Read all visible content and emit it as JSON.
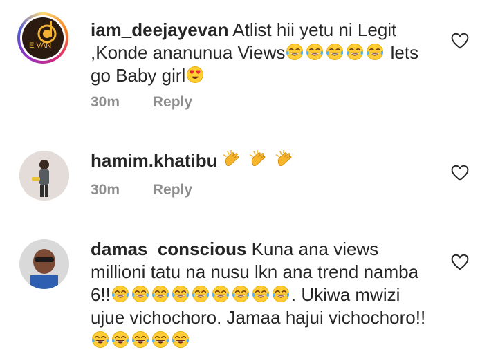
{
  "comments": [
    {
      "username": "iam_deejayevan",
      "segments": [
        {
          "t": "text",
          "v": "Atlist hii yetu ni Legit ,Konde ananunua Views"
        },
        {
          "t": "emoji",
          "name": "laugh"
        },
        {
          "t": "emoji",
          "name": "laugh"
        },
        {
          "t": "emoji",
          "name": "laugh"
        },
        {
          "t": "emoji",
          "name": "laugh"
        },
        {
          "t": "emoji",
          "name": "laugh"
        },
        {
          "t": "text",
          "v": " lets go Baby girl"
        },
        {
          "t": "emoji",
          "name": "heart-eyes"
        }
      ],
      "time": "30m",
      "reply": "Reply",
      "avatar_text": "E VAN"
    },
    {
      "username": "hamim.khatibu",
      "segments": [
        {
          "t": "emoji",
          "name": "clap"
        },
        {
          "t": "emoji",
          "name": "clap"
        },
        {
          "t": "emoji",
          "name": "clap"
        }
      ],
      "time": "30m",
      "reply": "Reply"
    },
    {
      "username": "damas_conscious",
      "segments": [
        {
          "t": "text",
          "v": "Kuna ana views millioni tatu na nusu lkn ana trend namba 6!!"
        },
        {
          "t": "emoji",
          "name": "laugh"
        },
        {
          "t": "emoji",
          "name": "laugh"
        },
        {
          "t": "emoji",
          "name": "laugh"
        },
        {
          "t": "emoji",
          "name": "laugh"
        },
        {
          "t": "emoji",
          "name": "laugh"
        },
        {
          "t": "emoji",
          "name": "laugh"
        },
        {
          "t": "emoji",
          "name": "laugh"
        },
        {
          "t": "emoji",
          "name": "laugh"
        },
        {
          "t": "emoji",
          "name": "laugh"
        },
        {
          "t": "text",
          "v": ". Ukiwa mwizi ujue vichochoro. Jamaa hajui vichochoro!!"
        },
        {
          "t": "emoji",
          "name": "laugh"
        },
        {
          "t": "emoji",
          "name": "laugh"
        },
        {
          "t": "emoji",
          "name": "laugh"
        },
        {
          "t": "emoji",
          "name": "laugh"
        },
        {
          "t": "emoji",
          "name": "laugh"
        }
      ],
      "time": "",
      "reply": ""
    }
  ],
  "icons": {
    "like": "heart-outline-icon"
  },
  "colors": {
    "text": "#262626",
    "meta": "#8e8e8e",
    "emoji": "#ffcc33"
  }
}
